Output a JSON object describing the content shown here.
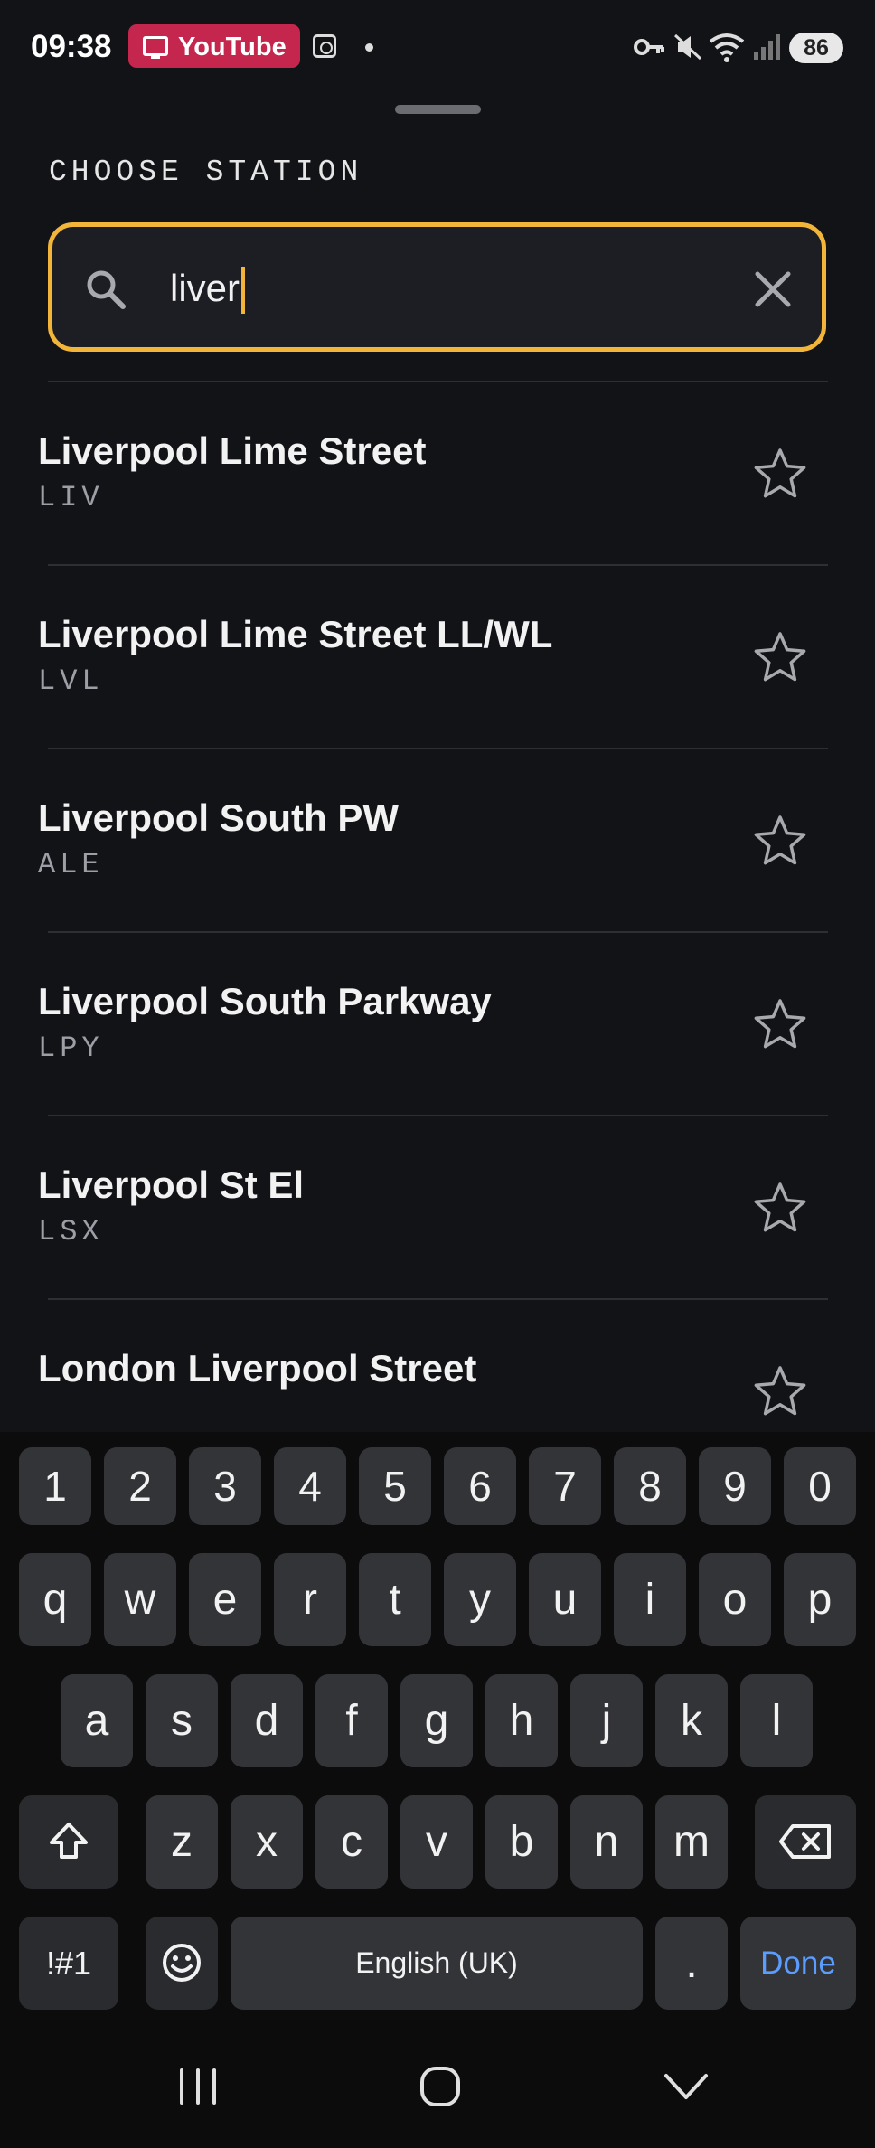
{
  "status_bar": {
    "time": "09:38",
    "app_chip": "YouTube",
    "battery": "86",
    "icons": [
      "screen-cast-icon",
      "screenshot-icon",
      "dot-icon",
      "vpn-key-icon",
      "mute-icon",
      "wifi-icon",
      "signal-icon",
      "battery-icon"
    ]
  },
  "sheet": {
    "title": "CHOOSE STATION",
    "search": {
      "value": "liver",
      "placeholder": ""
    }
  },
  "stations": [
    {
      "name": "Liverpool Lime Street",
      "code": "LIV"
    },
    {
      "name": "Liverpool Lime Street LL/WL",
      "code": "LVL"
    },
    {
      "name": "Liverpool South PW",
      "code": "ALE"
    },
    {
      "name": "Liverpool South Parkway",
      "code": "LPY"
    },
    {
      "name": "Liverpool St El",
      "code": "LSX"
    },
    {
      "name": "London Liverpool Street",
      "code": ""
    }
  ],
  "keyboard": {
    "row_numbers": [
      "1",
      "2",
      "3",
      "4",
      "5",
      "6",
      "7",
      "8",
      "9",
      "0"
    ],
    "row1": [
      "q",
      "w",
      "e",
      "r",
      "t",
      "y",
      "u",
      "i",
      "o",
      "p"
    ],
    "row2": [
      "a",
      "s",
      "d",
      "f",
      "g",
      "h",
      "j",
      "k",
      "l"
    ],
    "row3": [
      "z",
      "x",
      "c",
      "v",
      "b",
      "n",
      "m"
    ],
    "symbols_label": "!#1",
    "space_label": "English (UK)",
    "period_label": ".",
    "done_label": "Done"
  },
  "colors": {
    "background": "#121317",
    "accent": "#f3b43a",
    "done_blue": "#5b9cff",
    "youtube_chip": "#c4264d"
  }
}
